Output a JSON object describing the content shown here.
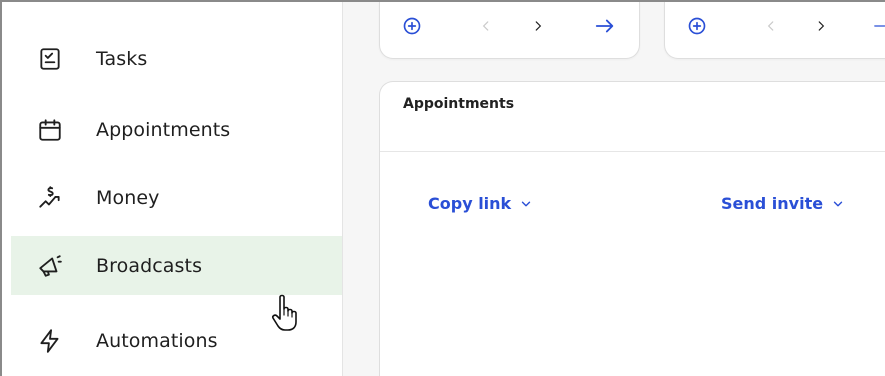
{
  "sidebar": {
    "items": [
      {
        "label": "Tasks",
        "icon": "tasks-icon"
      },
      {
        "label": "Appointments",
        "icon": "calendar-icon"
      },
      {
        "label": "Money",
        "icon": "money-icon"
      },
      {
        "label": "Broadcasts",
        "icon": "megaphone-icon",
        "active": true
      },
      {
        "label": "Automations",
        "icon": "lightning-icon"
      }
    ]
  },
  "main": {
    "card": {
      "title": "Appointments",
      "copy_link_label": "Copy link",
      "send_invite_label": "Send invite"
    }
  },
  "colors": {
    "accent": "#2a4fd6",
    "active_bg": "#e8f3e8",
    "main_bg": "#f6f6f6"
  }
}
